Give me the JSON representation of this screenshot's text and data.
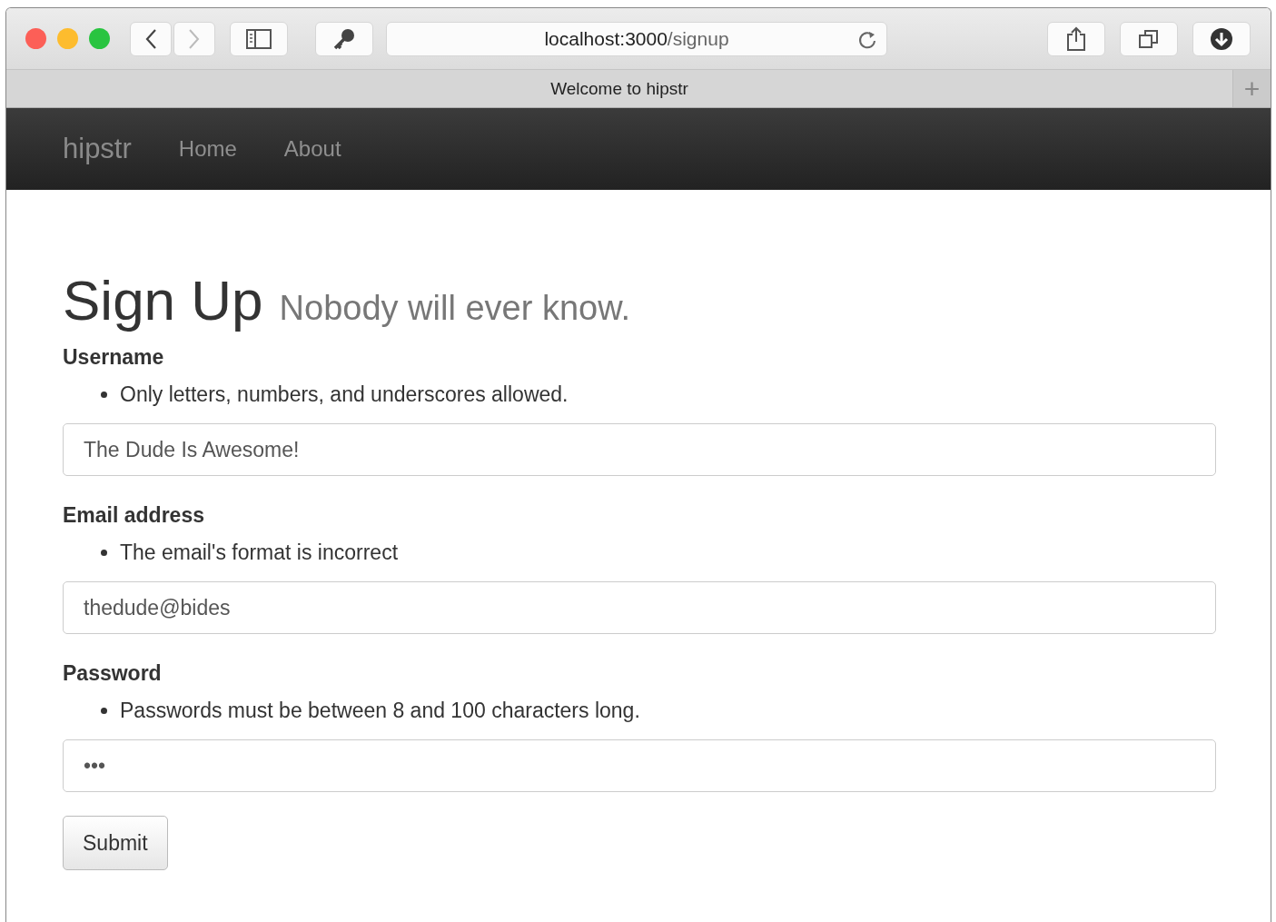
{
  "browser": {
    "url": {
      "host": "localhost:3000",
      "path": "/signup"
    },
    "tab_title": "Welcome to hipstr",
    "new_tab": "+"
  },
  "navbar": {
    "brand": "hipstr",
    "links": [
      {
        "label": "Home"
      },
      {
        "label": "About"
      }
    ]
  },
  "heading": {
    "title": "Sign Up",
    "subtitle": "Nobody will ever know."
  },
  "fields": [
    {
      "label": "Username",
      "errors": [
        "Only letters, numbers, and underscores allowed."
      ],
      "value": "The Dude Is Awesome!"
    },
    {
      "label": "Email address",
      "errors": [
        "The email's format is incorrect"
      ],
      "value": "thedude@bides"
    },
    {
      "label": "Password",
      "errors": [
        "Passwords must be between 8 and 100 characters long."
      ],
      "value": "•••"
    }
  ],
  "submit": "Submit"
}
